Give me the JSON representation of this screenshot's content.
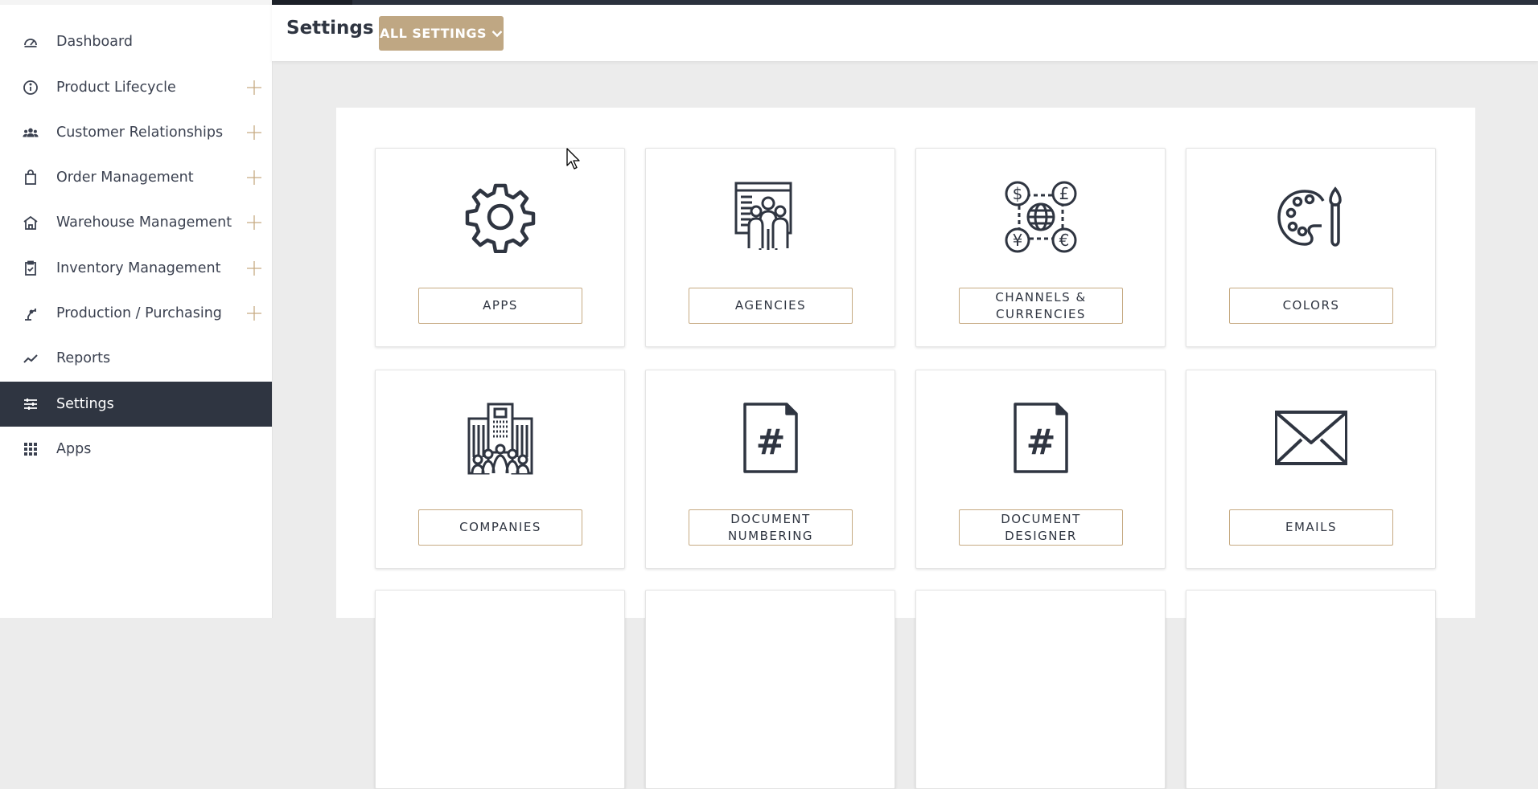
{
  "sidebar": {
    "items": [
      {
        "label": "Dashboard",
        "icon": "dashboard-icon",
        "expandable": false,
        "active": false
      },
      {
        "label": "Product Lifecycle",
        "icon": "info-icon",
        "expandable": true,
        "active": false
      },
      {
        "label": "Customer Relationships",
        "icon": "people-icon",
        "expandable": true,
        "active": false
      },
      {
        "label": "Order Management",
        "icon": "shopping-bag-icon",
        "expandable": true,
        "active": false
      },
      {
        "label": "Warehouse Management",
        "icon": "warehouse-icon",
        "expandable": true,
        "active": false
      },
      {
        "label": "Inventory Management",
        "icon": "clipboard-check-icon",
        "expandable": true,
        "active": false
      },
      {
        "label": "Production / Purchasing",
        "icon": "robot-arm-icon",
        "expandable": true,
        "active": false
      },
      {
        "label": "Reports",
        "icon": "chart-line-icon",
        "expandable": false,
        "active": false
      },
      {
        "label": "Settings",
        "icon": "sliders-icon",
        "expandable": false,
        "active": true
      },
      {
        "label": "Apps",
        "icon": "grid-icon",
        "expandable": false,
        "active": false
      }
    ]
  },
  "header": {
    "title": "Settings",
    "dropdown_label": "ALL SETTINGS"
  },
  "cards": [
    {
      "label": "APPS",
      "icon": "gear-icon"
    },
    {
      "label": "AGENCIES",
      "icon": "agencies-icon"
    },
    {
      "label": "CHANNELS & CURRENCIES",
      "icon": "currencies-globe-icon"
    },
    {
      "label": "COLORS",
      "icon": "palette-icon"
    },
    {
      "label": "COMPANIES",
      "icon": "building-icon"
    },
    {
      "label": "DOCUMENT NUMBERING",
      "icon": "document-hash-icon"
    },
    {
      "label": "DOCUMENT DESIGNER",
      "icon": "document-hash-icon"
    },
    {
      "label": "EMAILS",
      "icon": "envelope-icon"
    }
  ],
  "colors": {
    "accent": "#bfa783",
    "sidebar_active": "#2f3541",
    "text": "#2f3541"
  }
}
